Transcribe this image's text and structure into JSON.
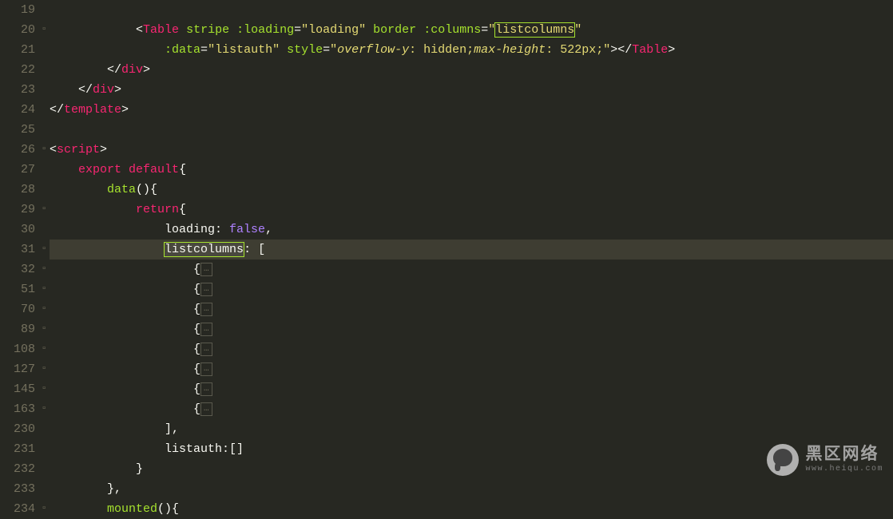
{
  "lines": [
    {
      "num": "19",
      "fold": "",
      "segs": []
    },
    {
      "num": "20",
      "fold": "▫",
      "segs": [
        {
          "t": "text",
          "v": "            "
        },
        {
          "t": "bracket",
          "v": "<"
        },
        {
          "t": "tag",
          "v": "Table"
        },
        {
          "t": "text",
          "v": " "
        },
        {
          "t": "attr",
          "v": "stripe"
        },
        {
          "t": "text",
          "v": " "
        },
        {
          "t": "attr",
          "v": ":loading"
        },
        {
          "t": "text",
          "v": "="
        },
        {
          "t": "string",
          "v": "\"loading\""
        },
        {
          "t": "text",
          "v": " "
        },
        {
          "t": "attr",
          "v": "border"
        },
        {
          "t": "text",
          "v": " "
        },
        {
          "t": "attr",
          "v": ":columns"
        },
        {
          "t": "text",
          "v": "="
        },
        {
          "t": "string",
          "v": "\""
        },
        {
          "t": "selstr",
          "v": "listcolumns"
        },
        {
          "t": "string",
          "v": "\""
        }
      ]
    },
    {
      "num": "21",
      "fold": "",
      "segs": [
        {
          "t": "text",
          "v": "                "
        },
        {
          "t": "attr",
          "v": ":data"
        },
        {
          "t": "text",
          "v": "="
        },
        {
          "t": "string",
          "v": "\"listauth\""
        },
        {
          "t": "text",
          "v": " "
        },
        {
          "t": "attr",
          "v": "style"
        },
        {
          "t": "text",
          "v": "="
        },
        {
          "t": "string",
          "v": "\""
        },
        {
          "t": "string-it",
          "v": "overflow-y"
        },
        {
          "t": "string",
          "v": ": hidden;"
        },
        {
          "t": "string-it",
          "v": "max-height"
        },
        {
          "t": "string",
          "v": ": 522px;\""
        },
        {
          "t": "bracket",
          "v": "></"
        },
        {
          "t": "tag",
          "v": "Table"
        },
        {
          "t": "bracket",
          "v": ">"
        }
      ]
    },
    {
      "num": "22",
      "fold": "",
      "segs": [
        {
          "t": "text",
          "v": "        "
        },
        {
          "t": "bracket",
          "v": "</"
        },
        {
          "t": "tag",
          "v": "div"
        },
        {
          "t": "bracket",
          "v": ">"
        }
      ]
    },
    {
      "num": "23",
      "fold": "",
      "segs": [
        {
          "t": "text",
          "v": "    "
        },
        {
          "t": "bracket",
          "v": "</"
        },
        {
          "t": "tag",
          "v": "div"
        },
        {
          "t": "bracket",
          "v": ">"
        }
      ]
    },
    {
      "num": "24",
      "fold": "",
      "segs": [
        {
          "t": "bracket",
          "v": "</"
        },
        {
          "t": "tag",
          "v": "template"
        },
        {
          "t": "bracket",
          "v": ">"
        }
      ]
    },
    {
      "num": "25",
      "fold": "",
      "segs": []
    },
    {
      "num": "26",
      "fold": "▫",
      "segs": [
        {
          "t": "bracket",
          "v": "<"
        },
        {
          "t": "tag",
          "v": "script"
        },
        {
          "t": "bracket",
          "v": ">"
        }
      ]
    },
    {
      "num": "27",
      "fold": "",
      "segs": [
        {
          "t": "text",
          "v": "    "
        },
        {
          "t": "keyword",
          "v": "export"
        },
        {
          "t": "text",
          "v": " "
        },
        {
          "t": "keyword",
          "v": "default"
        },
        {
          "t": "text",
          "v": "{"
        }
      ]
    },
    {
      "num": "28",
      "fold": "",
      "segs": [
        {
          "t": "text",
          "v": "        "
        },
        {
          "t": "name-fn",
          "v": "data"
        },
        {
          "t": "text",
          "v": "(){"
        }
      ]
    },
    {
      "num": "29",
      "fold": "▫",
      "segs": [
        {
          "t": "text",
          "v": "            "
        },
        {
          "t": "keyword",
          "v": "return"
        },
        {
          "t": "text",
          "v": "{"
        }
      ]
    },
    {
      "num": "30",
      "fold": "",
      "segs": [
        {
          "t": "text",
          "v": "                loading: "
        },
        {
          "t": "const",
          "v": "false"
        },
        {
          "t": "text",
          "v": ","
        }
      ]
    },
    {
      "num": "31",
      "fold": "▫",
      "hl": true,
      "segs": [
        {
          "t": "text",
          "v": "                "
        },
        {
          "t": "selplain",
          "v": "listcolumns"
        },
        {
          "t": "text",
          "v": ": ["
        }
      ]
    },
    {
      "num": "32",
      "fold": "▫",
      "segs": [
        {
          "t": "text",
          "v": "                    {"
        },
        {
          "t": "fold",
          "v": "…"
        }
      ]
    },
    {
      "num": "51",
      "fold": "▫",
      "segs": [
        {
          "t": "text",
          "v": "                    {"
        },
        {
          "t": "fold",
          "v": "…"
        }
      ]
    },
    {
      "num": "70",
      "fold": "▫",
      "segs": [
        {
          "t": "text",
          "v": "                    {"
        },
        {
          "t": "fold",
          "v": "…"
        }
      ]
    },
    {
      "num": "89",
      "fold": "▫",
      "segs": [
        {
          "t": "text",
          "v": "                    {"
        },
        {
          "t": "fold",
          "v": "…"
        }
      ]
    },
    {
      "num": "108",
      "fold": "▫",
      "segs": [
        {
          "t": "text",
          "v": "                    {"
        },
        {
          "t": "fold",
          "v": "…"
        }
      ]
    },
    {
      "num": "127",
      "fold": "▫",
      "segs": [
        {
          "t": "text",
          "v": "                    {"
        },
        {
          "t": "fold",
          "v": "…"
        }
      ]
    },
    {
      "num": "145",
      "fold": "▫",
      "segs": [
        {
          "t": "text",
          "v": "                    {"
        },
        {
          "t": "fold",
          "v": "…"
        }
      ]
    },
    {
      "num": "163",
      "fold": "▫",
      "segs": [
        {
          "t": "text",
          "v": "                    {"
        },
        {
          "t": "fold",
          "v": "…"
        }
      ]
    },
    {
      "num": "230",
      "fold": "",
      "segs": [
        {
          "t": "text",
          "v": "                ],"
        }
      ]
    },
    {
      "num": "231",
      "fold": "",
      "segs": [
        {
          "t": "text",
          "v": "                listauth:[]"
        }
      ]
    },
    {
      "num": "232",
      "fold": "",
      "segs": [
        {
          "t": "text",
          "v": "            }"
        }
      ]
    },
    {
      "num": "233",
      "fold": "",
      "segs": [
        {
          "t": "text",
          "v": "        },"
        }
      ]
    },
    {
      "num": "234",
      "fold": "▫",
      "segs": [
        {
          "t": "text",
          "v": "        "
        },
        {
          "t": "name-fn",
          "v": "mounted"
        },
        {
          "t": "text",
          "v": "(){"
        }
      ]
    }
  ],
  "watermark": {
    "cn": "黑区网络",
    "en": "www.heiqu.com"
  }
}
